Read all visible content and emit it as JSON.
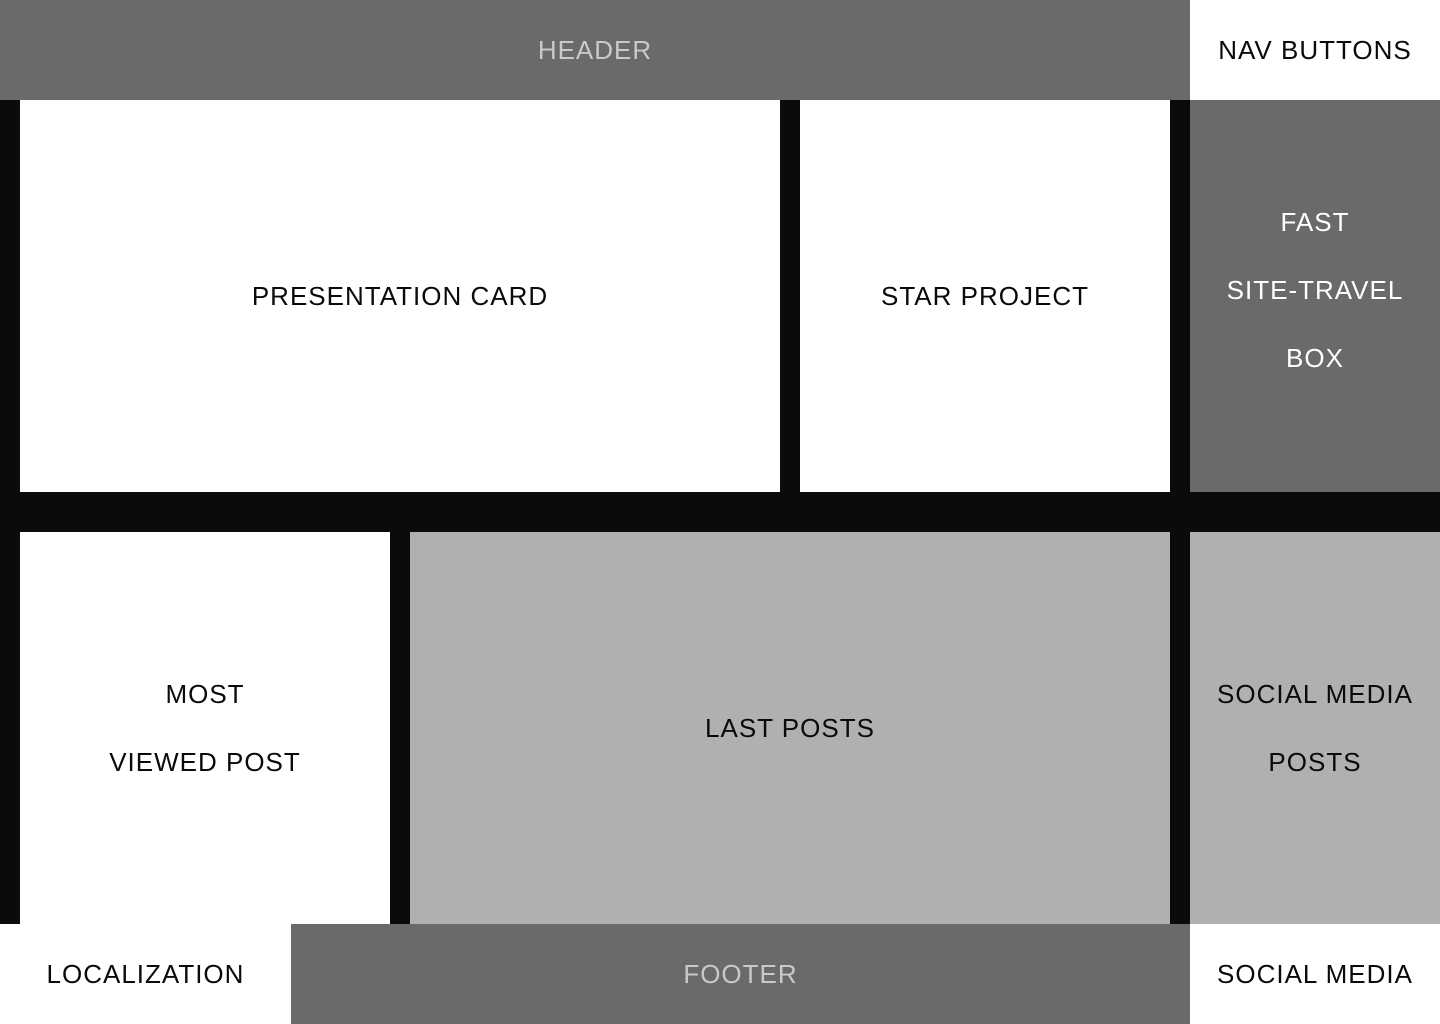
{
  "blocks": {
    "header": "HEADER",
    "nav_buttons": "NAV BUTTONS",
    "presentation_card": "PRESENTATION CARD",
    "star_project": "STAR PROJECT",
    "fast_site_travel": [
      "FAST",
      "SITE-TRAVEL",
      "BOX"
    ],
    "most_viewed_post": [
      "MOST",
      "VIEWED POST"
    ],
    "last_posts": "LAST POSTS",
    "social_media_posts": [
      "SOCIAL MEDIA",
      "POSTS"
    ],
    "localization": "LOCALIZATION",
    "footer": "FOOTER",
    "social_media": "SOCIAL MEDIA"
  },
  "colors": {
    "background": "#0b0b0b",
    "dark_block": "#6a6a6a",
    "white_block": "#ffffff",
    "light_block": "#b0b0b0"
  }
}
